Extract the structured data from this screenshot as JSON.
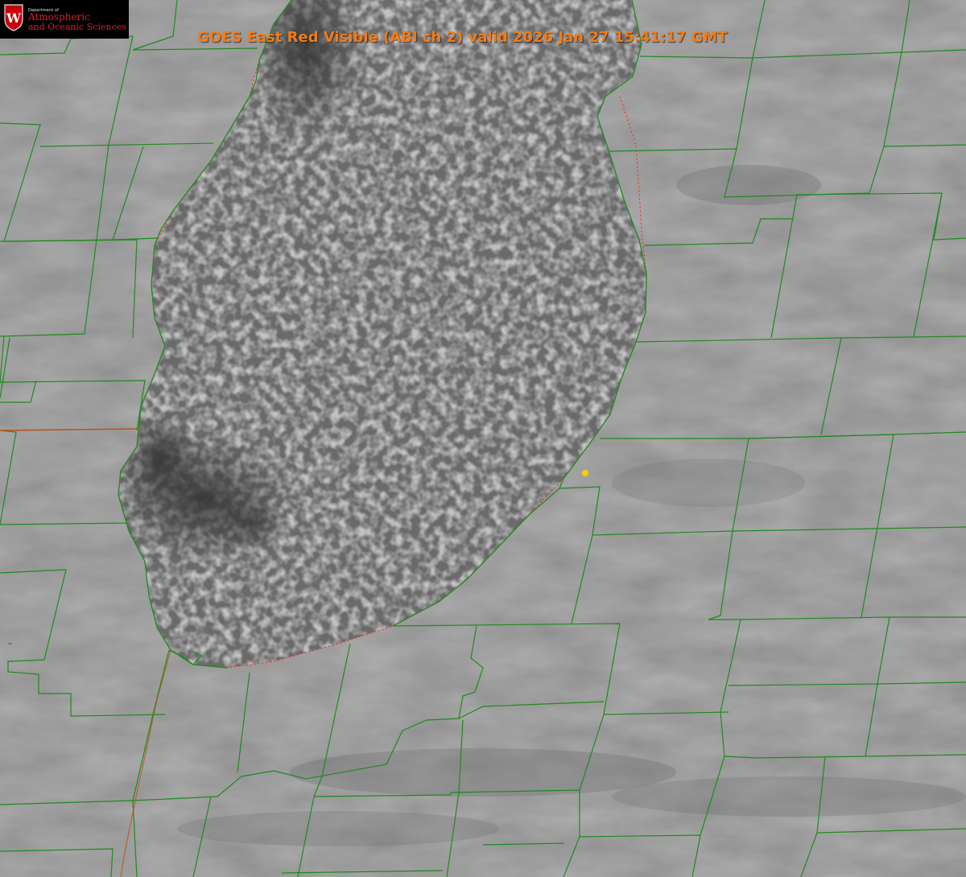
{
  "title": "GOES East Red Visible (ABI ch 2) valid 2026 Jan 27 15:41:17 GMT",
  "logo": {
    "line1": "Department of",
    "line2": "Atmospheric",
    "line3": "and Oceanic Sciences",
    "shield_letter": "W",
    "shield_color": "#c5050c"
  },
  "colors": {
    "title": "#f07c1a",
    "county_lines": "#1f8a1f",
    "state_line": "#b8541a",
    "shoreline_dotted": "#ff2a2a",
    "marker": "#f2d200"
  },
  "map": {
    "feature": "lake-effect cumulus field over lake",
    "marker_icon": "location-dot-icon"
  }
}
